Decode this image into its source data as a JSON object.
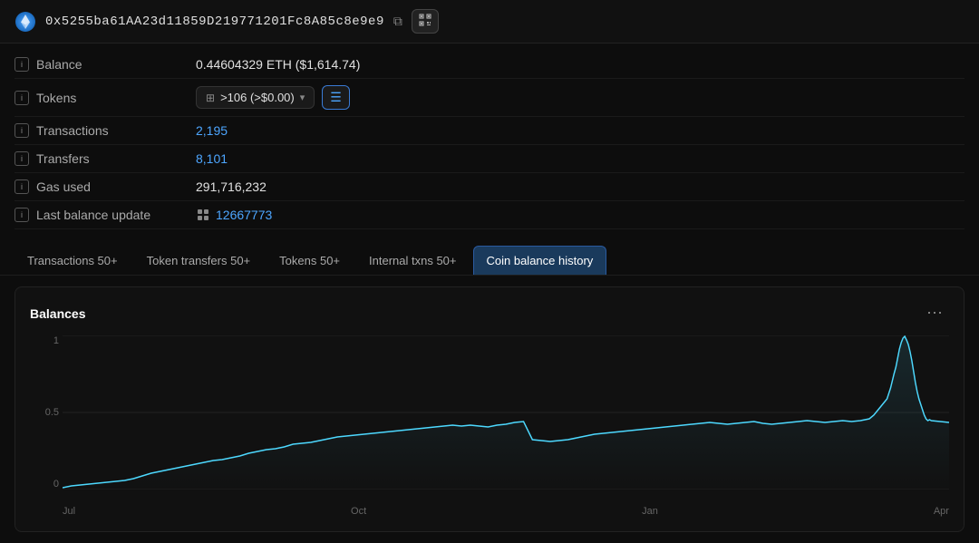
{
  "header": {
    "address": "0x5255ba61AA23d11859D219771201Fc8A85c8e9e9",
    "copy_tooltip": "Copy address",
    "qr_label": "QR"
  },
  "info_rows": [
    {
      "id": "balance",
      "label": "Balance",
      "value": "0.44604329 ETH ($1,614.74)",
      "is_link": false
    },
    {
      "id": "tokens",
      "label": "Tokens",
      "dropdown_text": ">106 (>$0.00)",
      "is_link": false,
      "is_token": true
    },
    {
      "id": "transactions",
      "label": "Transactions",
      "value": "2,195",
      "is_link": true
    },
    {
      "id": "transfers",
      "label": "Transfers",
      "value": "8,101",
      "is_link": true
    },
    {
      "id": "gas_used",
      "label": "Gas used",
      "value": "291,716,232",
      "is_link": false
    },
    {
      "id": "last_balance_update",
      "label": "Last balance update",
      "value": "12667773",
      "is_link": true
    }
  ],
  "tabs": [
    {
      "id": "transactions",
      "label": "Transactions 50+",
      "active": false
    },
    {
      "id": "token_transfers",
      "label": "Token transfers 50+",
      "active": false
    },
    {
      "id": "tokens",
      "label": "Tokens 50+",
      "active": false
    },
    {
      "id": "internal_txns",
      "label": "Internal txns 50+",
      "active": false
    },
    {
      "id": "coin_balance_history",
      "label": "Coin balance history",
      "active": true
    }
  ],
  "chart": {
    "title": "Balances",
    "menu_label": "⋯",
    "y_labels": [
      "1",
      "0.5",
      "0"
    ],
    "x_labels": [
      "Jul",
      "Oct",
      "Jan",
      "Apr"
    ]
  }
}
